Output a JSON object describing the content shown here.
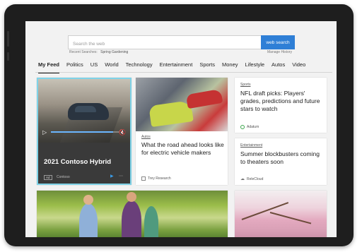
{
  "search": {
    "placeholder": "Search the web",
    "button_label": "web search",
    "recent_label": "Recent Searches:",
    "recent_item": "Spring Gardening",
    "manage_label": "Manage History"
  },
  "nav": {
    "items": [
      "My Feed",
      "Politics",
      "US",
      "World",
      "Technology",
      "Entertainment",
      "Sports",
      "Money",
      "Lifestyle",
      "Autos",
      "Video"
    ],
    "active": "My Feed"
  },
  "hero": {
    "title": "2021 Contoso Hybrid",
    "ad_badge": "Ad",
    "source": "Contoso",
    "progress_fraction": 0.88
  },
  "card_autos": {
    "category": "Autos",
    "headline": "What the road ahead looks like for electric vehicle makers",
    "source": "Trey Research"
  },
  "card_sports": {
    "category": "Sports",
    "headline": "NFL draft picks: Players' grades, predictions and future stars to watch",
    "source": "Adatum"
  },
  "card_entertainment": {
    "category": "Entertainment",
    "headline": "Summer blockbusters coming to theaters soon",
    "source": "ReleCloud"
  },
  "colors": {
    "accent": "#2f7fd6",
    "hero_border": "#7fd3e8"
  }
}
